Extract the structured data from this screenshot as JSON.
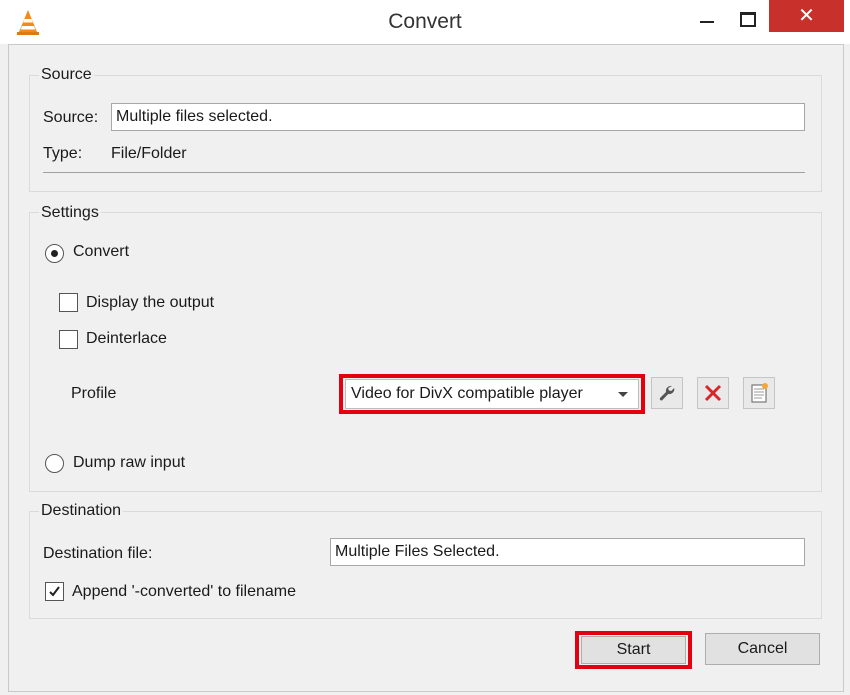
{
  "window": {
    "title": "Convert",
    "close_glyph": "✕",
    "icons": [
      "vlc-cone-icon",
      "minimize-icon",
      "maximize-icon",
      "close-icon"
    ]
  },
  "source": {
    "group_label": "Source",
    "source_label": "Source:",
    "source_value": "Multiple files selected.",
    "type_label": "Type:",
    "type_value": "File/Folder"
  },
  "settings": {
    "group_label": "Settings",
    "convert_label": "Convert",
    "convert_selected": true,
    "display_output_label": "Display the output",
    "display_output_checked": false,
    "deinterlace_label": "Deinterlace",
    "deinterlace_checked": false,
    "profile_label": "Profile",
    "profile_value": "Video for DivX compatible player",
    "dump_raw_label": "Dump raw input",
    "dump_raw_selected": false,
    "profile_buttons": [
      "wrench-icon",
      "delete-x-icon",
      "new-profile-icon"
    ]
  },
  "destination": {
    "group_label": "Destination",
    "file_label": "Destination file:",
    "file_value": "Multiple Files Selected.",
    "append_label": "Append '-converted' to filename",
    "append_checked": true
  },
  "buttons": {
    "start": "Start",
    "cancel": "Cancel"
  },
  "colors": {
    "highlight": "#e3000f",
    "close_button": "#c7302b",
    "delete_icon": "#d9262b"
  }
}
